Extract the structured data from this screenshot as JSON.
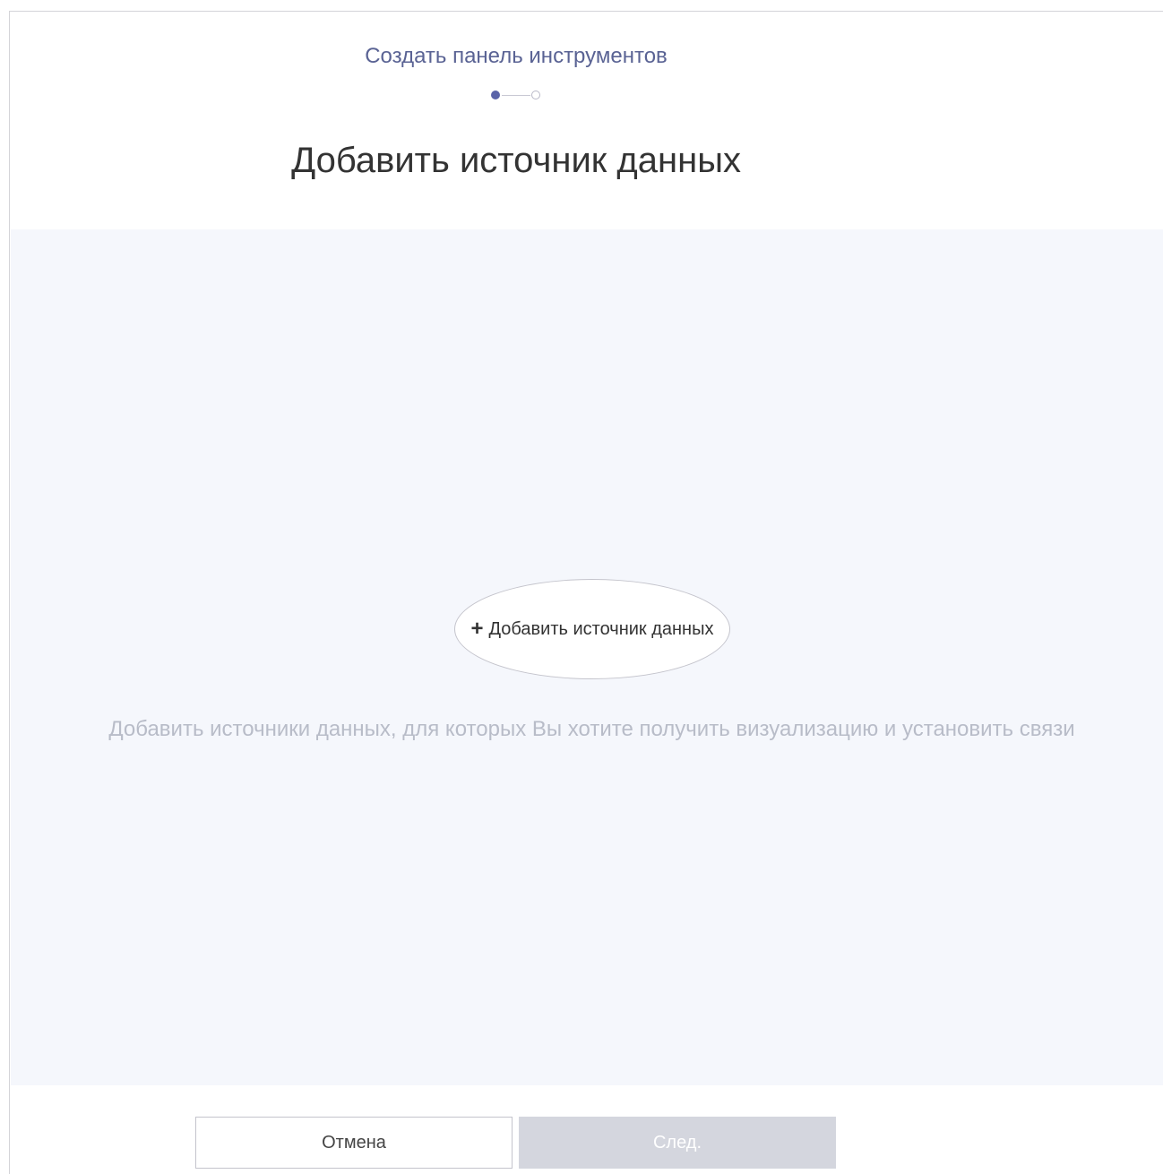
{
  "wizard": {
    "title": "Создать панель инструментов",
    "steps": {
      "total": 2,
      "current": 1
    },
    "heading": "Добавить источник данных"
  },
  "drop_zone": {
    "add_button_label": "Добавить источник данных",
    "add_icon": "plus-icon",
    "hint": "Добавить источники данных, для которых Вы хотите получить визуализацию и установить связи"
  },
  "footer": {
    "cancel_label": "Отмена",
    "next_label": "След.",
    "next_enabled": false
  },
  "colors": {
    "accent": "#5a63a8",
    "drop_zone_bg": "#f5f7fc",
    "disabled_button": "#d4d6de"
  }
}
